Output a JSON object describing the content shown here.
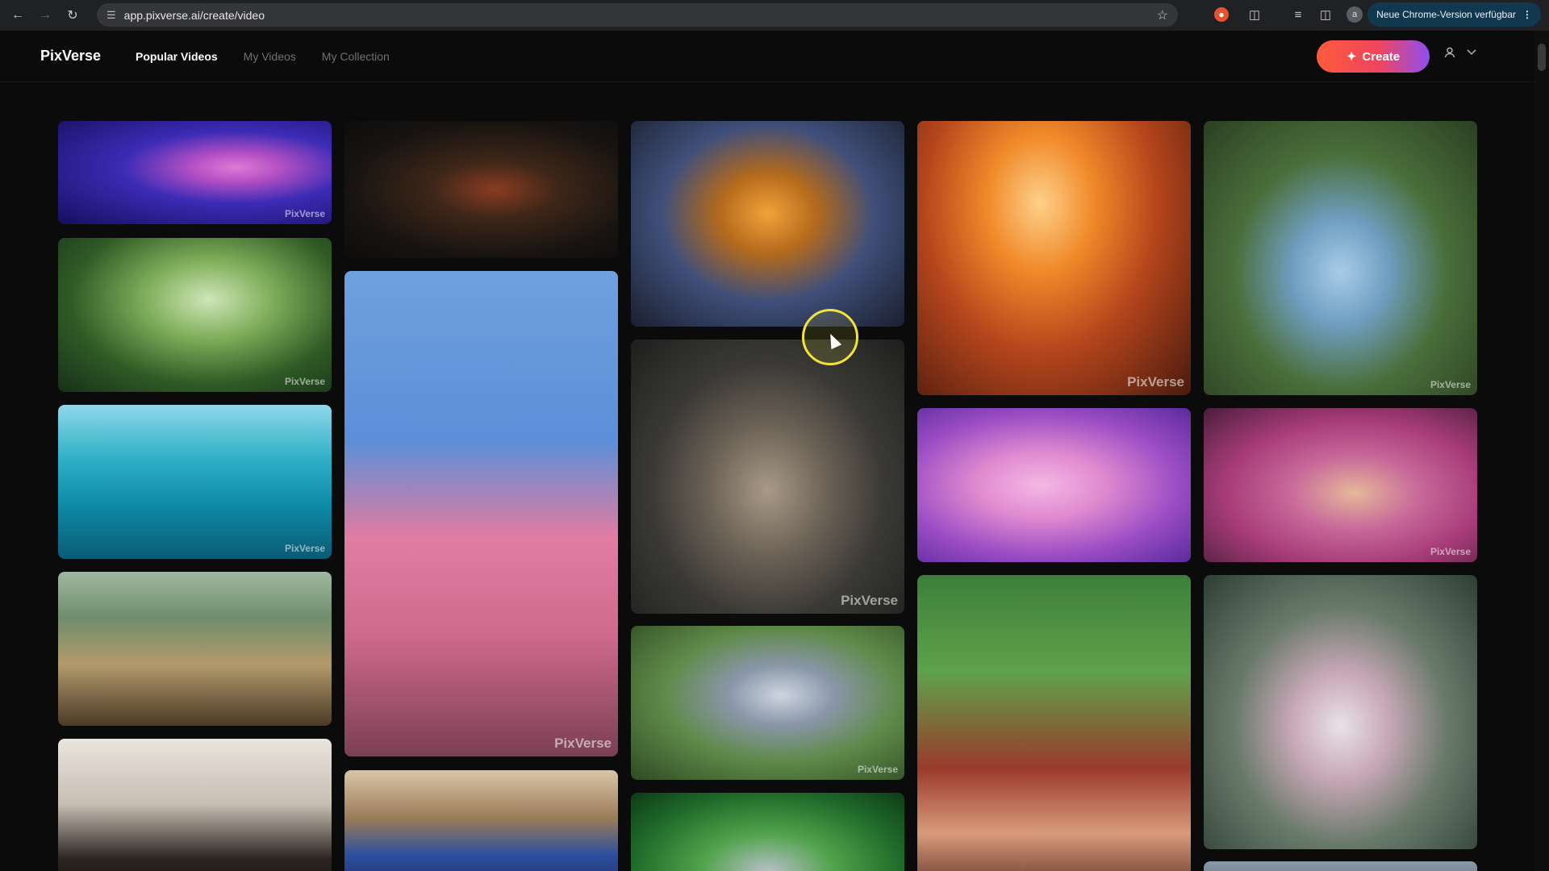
{
  "browser": {
    "url": "app.pixverse.ai/create/video",
    "update_label": "Neue Chrome-Version verfügbar",
    "profile_initial": "a"
  },
  "header": {
    "logo": "PixVerse",
    "nav": [
      {
        "label": "Popular Videos",
        "active": true
      },
      {
        "label": "My Videos",
        "active": false
      },
      {
        "label": "My Collection",
        "active": false
      }
    ],
    "create_label": "Create"
  },
  "watermark": "PixVerse",
  "colors": {
    "background": "#0b0b0c",
    "create_gradient_start": "#ff5a3c",
    "create_gradient_end": "#8f4ef2",
    "cursor_highlight": "#f2e33b"
  },
  "gallery": [
    {
      "name": "thumb-pink-flower",
      "watermark": true
    },
    {
      "name": "thumb-leaf-droplets",
      "watermark": true
    },
    {
      "name": "thumb-sea-turtle",
      "watermark": true
    },
    {
      "name": "thumb-mushrooms",
      "watermark": false
    },
    {
      "name": "thumb-anime-girl",
      "watermark": false
    },
    {
      "name": "thumb-car-night-road",
      "watermark": false
    },
    {
      "name": "thumb-cherry-blossoms",
      "watermark": true
    },
    {
      "name": "thumb-blue-hair-anime",
      "watermark": false
    },
    {
      "name": "thumb-butterfly-fairy",
      "watermark": false
    },
    {
      "name": "thumb-kitten-flower",
      "watermark": true
    },
    {
      "name": "thumb-bunny",
      "watermark": true
    },
    {
      "name": "thumb-green-forest-creature",
      "watermark": false
    },
    {
      "name": "thumb-elephant-sunset",
      "watermark": true
    },
    {
      "name": "thumb-pink-cloud",
      "watermark": false
    },
    {
      "name": "thumb-cartoon-boy",
      "watermark": false
    },
    {
      "name": "thumb-girl-cherries",
      "watermark": true
    },
    {
      "name": "thumb-anime-boy-pink-room",
      "watermark": true
    },
    {
      "name": "thumb-witch-girl-pond",
      "watermark": false
    },
    {
      "name": "thumb-partial-bottom",
      "watermark": false
    }
  ]
}
